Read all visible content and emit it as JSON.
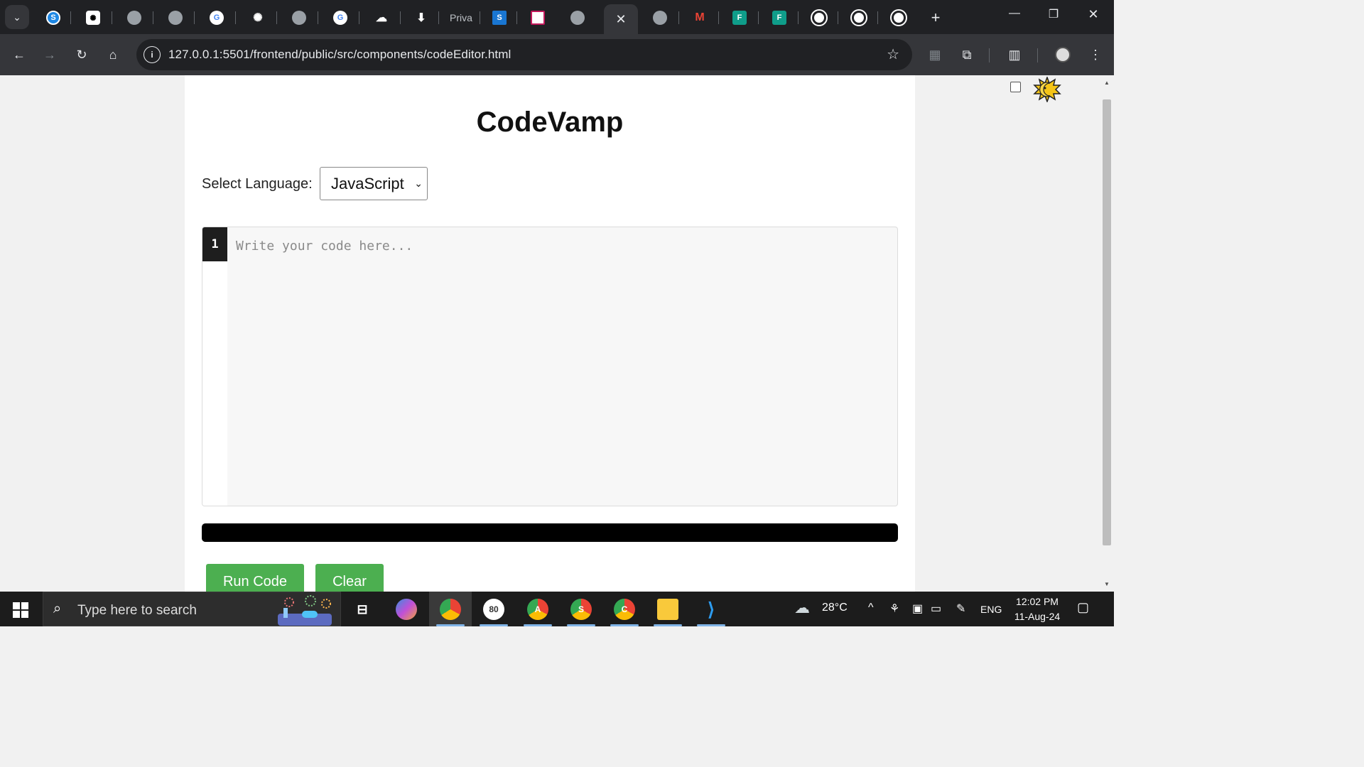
{
  "browser": {
    "tabs": [
      {
        "icon": "sonar-icon",
        "label": "S",
        "color": "#1e88e5"
      },
      {
        "icon": "chatgpt-icon",
        "label": "",
        "color": "#ffffff"
      },
      {
        "icon": "globe-icon",
        "label": "",
        "color": "#9aa0a6"
      },
      {
        "icon": "globe-icon",
        "label": "",
        "color": "#9aa0a6"
      },
      {
        "icon": "google-icon",
        "label": "G",
        "color": "#ffffff"
      },
      {
        "icon": "chatgpt-icon",
        "label": "",
        "color": "#ffffff"
      },
      {
        "icon": "globe-icon",
        "label": "",
        "color": "#9aa0a6"
      },
      {
        "icon": "google-icon",
        "label": "G",
        "color": "#ffffff"
      },
      {
        "icon": "cloud-icon",
        "label": "",
        "color": "#ffffff"
      },
      {
        "icon": "download-icon",
        "label": "",
        "color": "#ffffff"
      },
      {
        "icon": "text-tab",
        "label": "Priva",
        "color": ""
      },
      {
        "icon": "s-doc-icon",
        "label": "S",
        "color": "#1976d2"
      },
      {
        "icon": "document-icon",
        "label": "",
        "color": "#ffffff"
      },
      {
        "icon": "globe-icon",
        "label": "",
        "color": "#9aa0a6"
      },
      {
        "icon": "close-icon",
        "label": "✕",
        "color": ""
      },
      {
        "icon": "globe-icon",
        "label": "",
        "color": "#9aa0a6"
      },
      {
        "icon": "gmail-icon",
        "label": "M",
        "color": "#ea4335"
      },
      {
        "icon": "forms-icon",
        "label": "F",
        "color": "#0f9d8a"
      },
      {
        "icon": "forms-icon",
        "label": "F",
        "color": "#0f9d8a"
      },
      {
        "icon": "github-icon",
        "label": "",
        "color": "#ffffff"
      },
      {
        "icon": "github-icon",
        "label": "",
        "color": "#ffffff"
      },
      {
        "icon": "github-icon",
        "label": "",
        "color": "#ffffff"
      }
    ],
    "new_tab_label": "+",
    "window_controls": {
      "minimize": "—",
      "restore": "❐",
      "close": "✕"
    },
    "url": "127.0.0.1:5501/frontend/public/src/components/codeEditor.html"
  },
  "page": {
    "title": "CodeVamp",
    "language_label": "Select Language:",
    "language_selected": "JavaScript",
    "editor": {
      "line_number": "1",
      "placeholder": "Write your code here..."
    },
    "buttons": {
      "run": "Run Code",
      "clear": "Clear"
    }
  },
  "taskbar": {
    "search_placeholder": "Type here to search",
    "apps": [
      {
        "icon": "copilot-icon",
        "badge": ""
      },
      {
        "icon": "chrome-icon",
        "badge": ""
      },
      {
        "icon": "chrome-icon",
        "badge": "80"
      },
      {
        "icon": "chrome-icon",
        "badge": "A"
      },
      {
        "icon": "chrome-icon",
        "badge": "S"
      },
      {
        "icon": "chrome-icon",
        "badge": "C"
      },
      {
        "icon": "file-explorer-icon",
        "badge": ""
      },
      {
        "icon": "vscode-icon",
        "badge": ""
      }
    ],
    "weather": "28°C",
    "language": "ENG",
    "time": "12:02 PM",
    "date": "11-Aug-24"
  },
  "colors": {
    "accent_green": "#4caf50",
    "chrome_dark": "#202124",
    "toolbar": "#35363a"
  }
}
